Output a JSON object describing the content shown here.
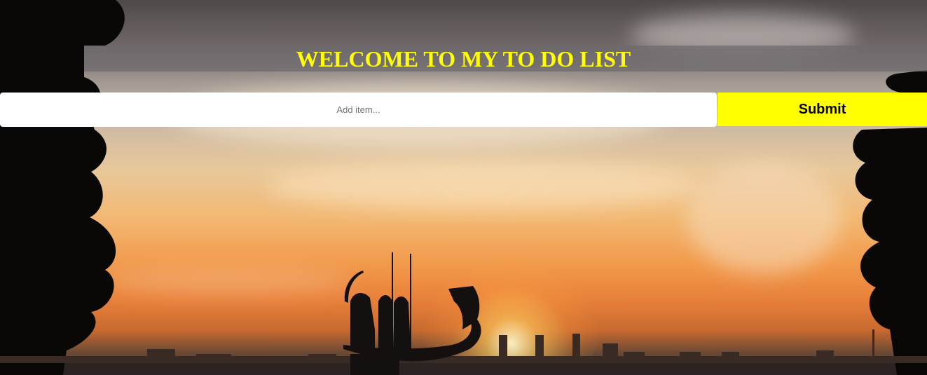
{
  "header": {
    "title": "WELCOME TO MY TO DO LIST"
  },
  "form": {
    "input_placeholder": "Add item...",
    "input_value": "",
    "submit_label": "Submit"
  },
  "colors": {
    "accent": "#ffff00",
    "title_bar": "#6e696e"
  },
  "background": {
    "subject": "sunset-skyline-photo"
  }
}
